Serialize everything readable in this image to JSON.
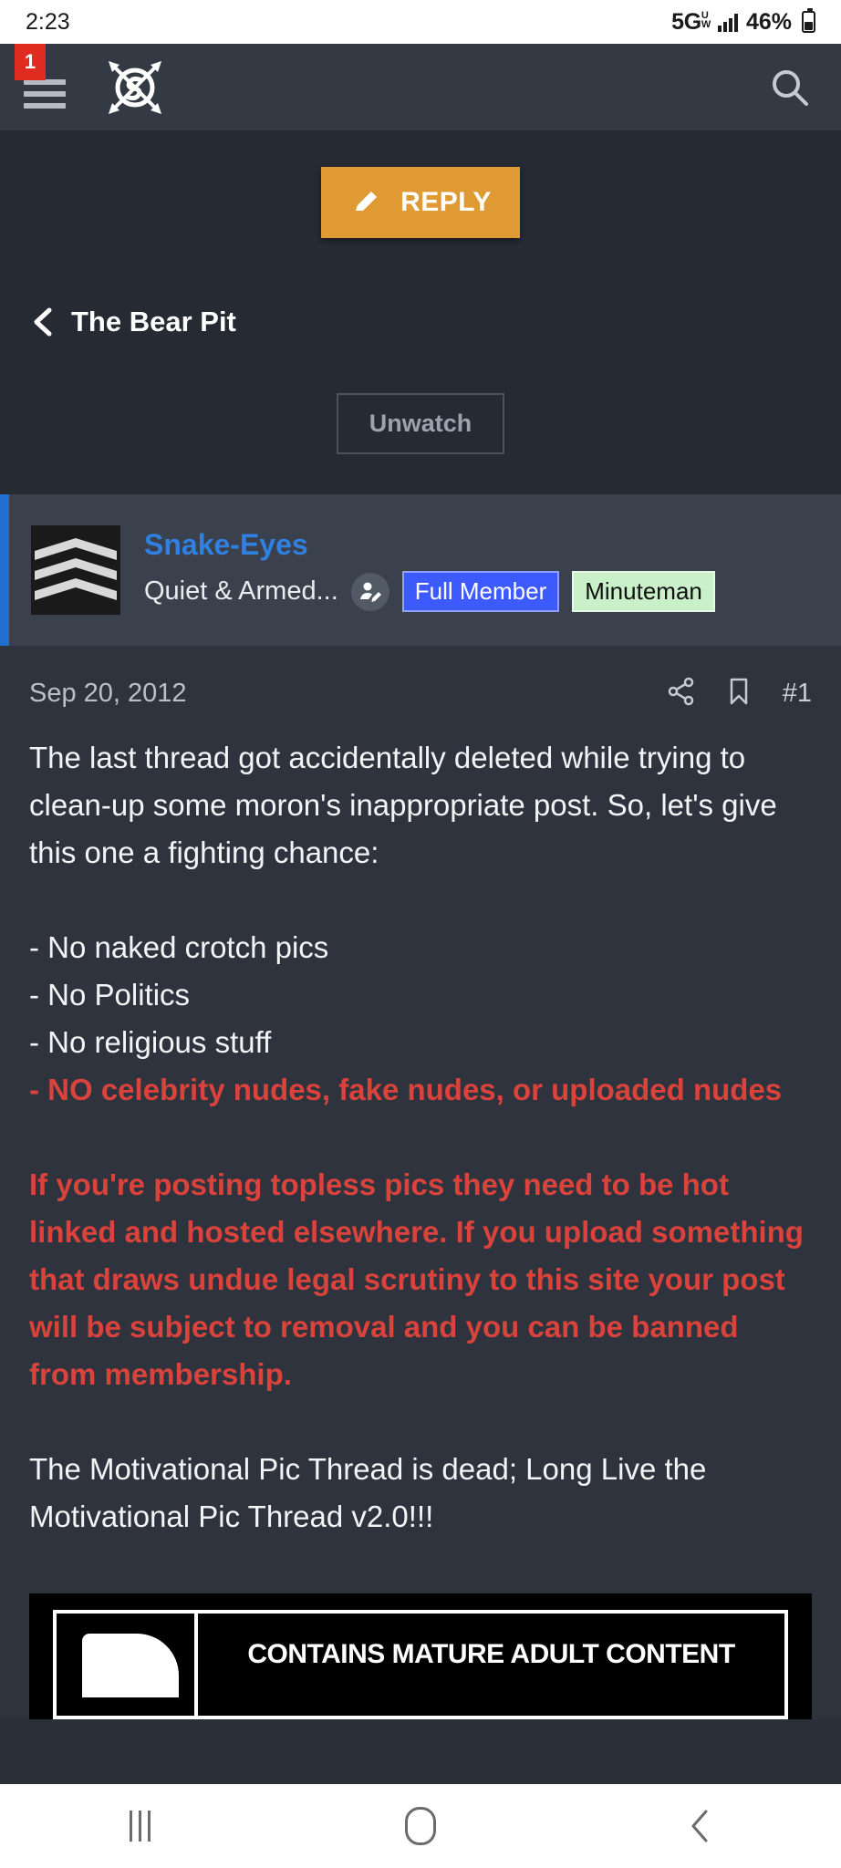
{
  "status_bar": {
    "time": "2:23",
    "network": "5G",
    "network_sub_top": "U",
    "network_sub_bottom": "W",
    "battery_percent": "46%",
    "battery_level": 46
  },
  "app_bar": {
    "notification_count": "1",
    "menu_icon": "hamburger-menu-icon",
    "logo_icon": "snake-eyes-crossed-arrows-logo",
    "search_icon": "search-icon"
  },
  "toolbar": {
    "reply_label": "REPLY",
    "reply_icon": "pencil-icon",
    "reply_color": "#df9a33"
  },
  "breadcrumb": {
    "back_icon": "chevron-left-icon",
    "label": "The Bear Pit"
  },
  "watch": {
    "unwatch_label": "Unwatch"
  },
  "user": {
    "avatar_icon": "chevron-rank-insignia-avatar",
    "username": "Snake-Eyes",
    "title": "Quiet & Armed...",
    "edit_icon": "user-edit-icon",
    "badges": [
      {
        "label": "Full Member",
        "color": "#3d5afe",
        "text_color": "#ffffff"
      },
      {
        "label": "Minuteman",
        "color": "#c9f0c9",
        "text_color": "#101010"
      }
    ],
    "accent_color": "#1f6fd0"
  },
  "post": {
    "date": "Sep 20, 2012",
    "share_icon": "share-icon",
    "bookmark_icon": "bookmark-icon",
    "post_number": "#1",
    "paragraph_1": "The last thread got accidentally deleted while trying to clean-up some moron's inappropriate post. So, let's give this one a fighting chance:",
    "rules": [
      "- No naked crotch pics",
      "- No Politics",
      "- No religious stuff"
    ],
    "rule_red": "- NO celebrity nudes, fake nudes, or uploaded nudes",
    "warning": "If you're posting topless pics they need to be hot linked and hosted elsewhere. If you upload something that draws undue legal scrutiny to this site your post will be subject to removal and you can be banned from membership.",
    "closing": "The Motivational Pic Thread is dead; Long Live the Motivational Pic Thread v2.0!!!",
    "warning_color": "#d9433c"
  },
  "attachment": {
    "label": "CONTAINS MATURE ADULT CONTENT",
    "icon": "warning-label-image"
  },
  "nav_bar": {
    "recents_icon": "recents-icon",
    "home_icon": "home-icon",
    "back_icon": "back-icon"
  }
}
